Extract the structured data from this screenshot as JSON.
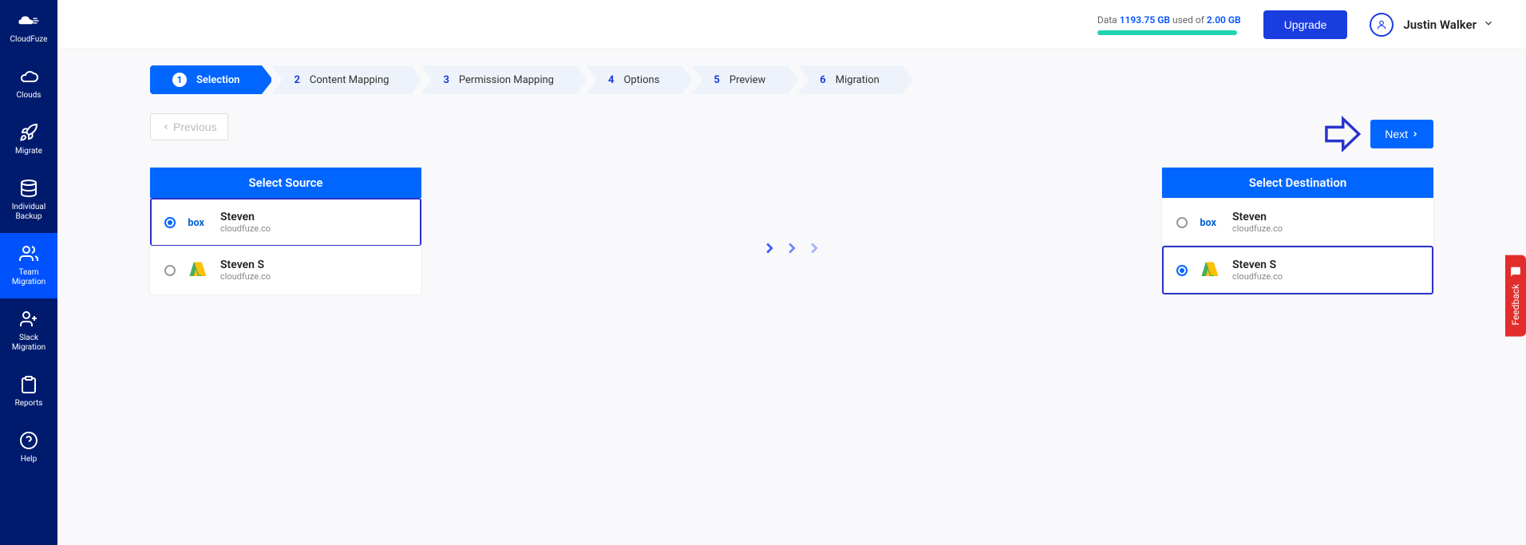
{
  "sidebar": {
    "items": [
      {
        "label": "CloudFuze",
        "icon": "logo"
      },
      {
        "label": "Clouds",
        "icon": "cloud"
      },
      {
        "label": "Migrate",
        "icon": "rocket"
      },
      {
        "label": "Individual Backup",
        "icon": "db"
      },
      {
        "label": "Team Migration",
        "icon": "team",
        "active": true
      },
      {
        "label": "Slack Migration",
        "icon": "team2"
      },
      {
        "label": "Reports",
        "icon": "clipboard"
      },
      {
        "label": "Help",
        "icon": "help"
      }
    ]
  },
  "topbar": {
    "data_label": "Data",
    "data_used": "1193.75 GB",
    "data_mid": "used of",
    "data_total": "2.00 GB",
    "upgrade": "Upgrade",
    "username": "Justin Walker"
  },
  "steps": [
    {
      "num": "1",
      "label": "Selection",
      "active": true
    },
    {
      "num": "2",
      "label": "Content Mapping"
    },
    {
      "num": "3",
      "label": "Permission Mapping"
    },
    {
      "num": "4",
      "label": "Options"
    },
    {
      "num": "5",
      "label": "Preview"
    },
    {
      "num": "6",
      "label": "Migration"
    }
  ],
  "nav": {
    "previous": "Previous",
    "next": "Next"
  },
  "panels": {
    "source": {
      "title": "Select Source",
      "accounts": [
        {
          "name": "Steven",
          "domain": "cloudfuze.co",
          "provider": "box",
          "selected": true
        },
        {
          "name": "Steven S",
          "domain": "cloudfuze.co",
          "provider": "gdrive",
          "selected": false
        }
      ]
    },
    "dest": {
      "title": "Select Destination",
      "accounts": [
        {
          "name": "Steven",
          "domain": "cloudfuze.co",
          "provider": "box",
          "selected": false
        },
        {
          "name": "Steven S",
          "domain": "cloudfuze.co",
          "provider": "gdrive",
          "selected": true
        }
      ]
    }
  },
  "feedback": "Feedback"
}
